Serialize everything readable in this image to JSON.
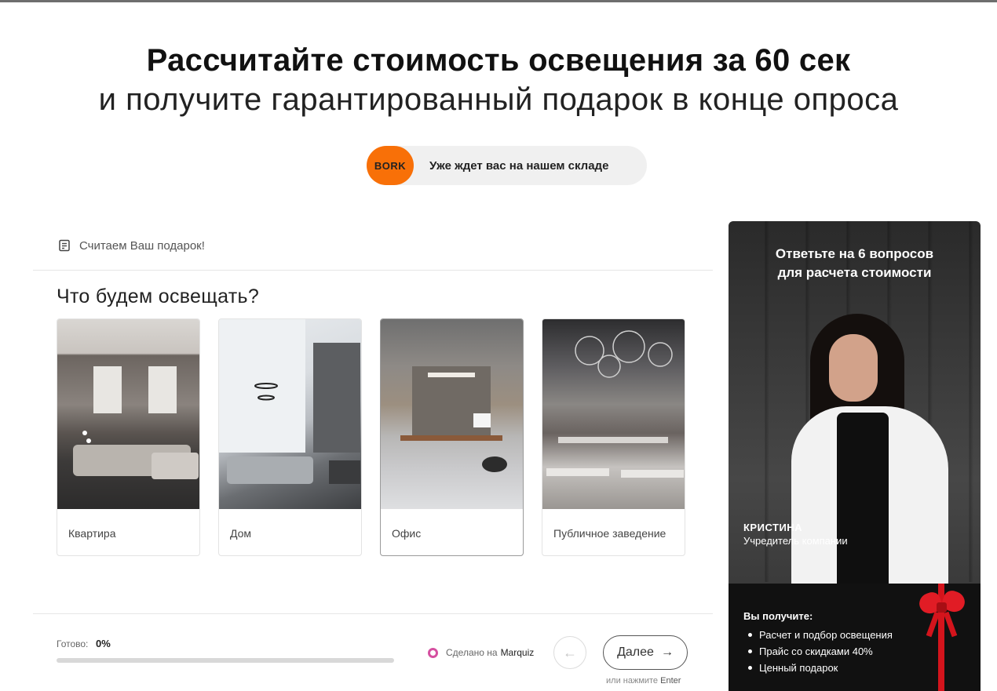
{
  "header": {
    "title_line1": "Рассчитайте стоимость освещения за 60 сек",
    "title_line2": "и получите гарантированный подарок в конце опроса"
  },
  "promo": {
    "logo_text": "BORK",
    "text": "Уже ждет вас на нашем складе",
    "logo_color": "#f87008"
  },
  "quiz": {
    "subtitle": "Считаем Ваш подарок!",
    "question": "Что будем освещать?",
    "options": [
      {
        "label": "Квартира"
      },
      {
        "label": "Дом"
      },
      {
        "label": "Офис"
      },
      {
        "label": "Публичное заведение"
      }
    ],
    "progress": {
      "label": "Готово:",
      "value": "0%",
      "fraction": 0
    },
    "made_with": {
      "prefix": "Сделано на",
      "brand": "Marquiz"
    },
    "next_label": "Далее",
    "hint_prefix": "или нажмите",
    "hint_key": "Enter"
  },
  "sidebar": {
    "title_line1": "Ответьте на 6 вопросов",
    "title_line2": "для расчета стоимости",
    "person_name": "КРИСТИНА",
    "person_role": "Учредитель компании",
    "gift_title": "Вы получите:",
    "gift_items": [
      "Расчет и подбор освещения",
      "Прайс со скидками 40%",
      "Ценный подарок"
    ]
  }
}
